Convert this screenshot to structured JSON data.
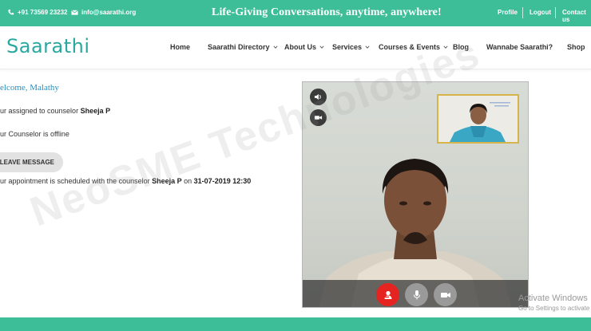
{
  "topbar": {
    "phone": "+91 73569 23232",
    "email": "info@saarathi.org",
    "tagline": "Life-Giving Conversations, anytime, anywhere!",
    "links": {
      "profile": "Profile",
      "logout": "Logout",
      "contact": "Contact us"
    }
  },
  "nav": {
    "logo_text": "Saarathi",
    "items": {
      "home": "Home",
      "directory": "Saarathi Directory",
      "about": "About Us",
      "services": "Services",
      "courses": "Courses & Events",
      "blog": "Blog",
      "wannabe": "Wannabe Saarathi?",
      "shop": "Shop"
    }
  },
  "content": {
    "welcome": "elcome, Malathy",
    "assigned_prefix": "ur assigned to counselor ",
    "counselor_name": "Sheeja P",
    "offline": "ur Counselor is offline",
    "leave_message": "LEAVE MESSAGE",
    "appointment_prefix": "ur appointment is scheduled with the counselor ",
    "appointment_counselor": "Sheeja P",
    "appointment_on": " on ",
    "appointment_datetime": "31-07-2019 12:30"
  },
  "watermark": "NeoSME Technologies",
  "os_notice": {
    "title": "Activate Windows",
    "subtitle": "Go to Settings to activate"
  },
  "colors": {
    "brand_green": "#3dbe99",
    "logo_teal": "#2aa8a0",
    "welcome_blue": "#2a8fbd",
    "end_call_red": "#e52320"
  }
}
